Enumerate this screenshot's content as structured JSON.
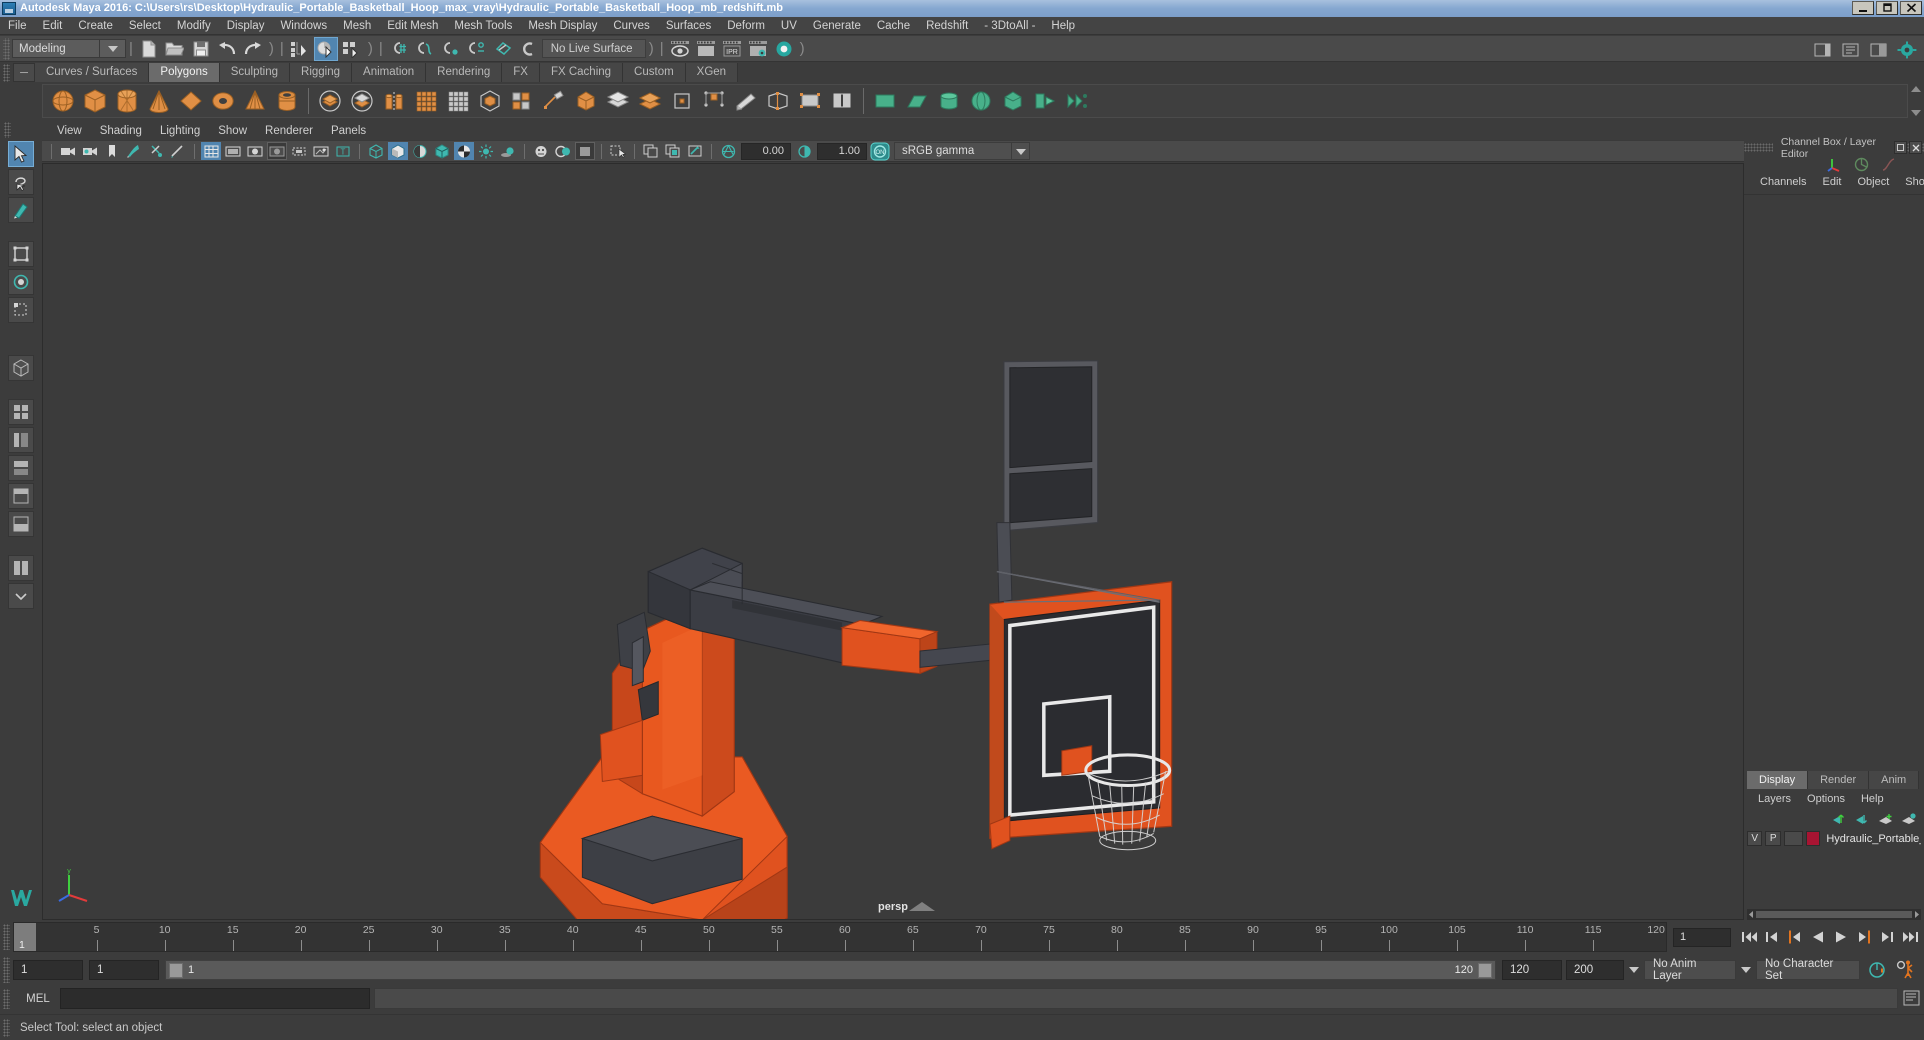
{
  "titlebar": {
    "title": "Autodesk Maya 2016: C:\\Users\\rs\\Desktop\\Hydraulic_Portable_Basketball_Hoop_max_vray\\Hydraulic_Portable_Basketball_Hoop_mb_redshift.mb",
    "minimize": "_",
    "restore": "❐",
    "close": "✕"
  },
  "menubar": {
    "items": [
      "File",
      "Edit",
      "Create",
      "Select",
      "Modify",
      "Display",
      "Windows",
      "Mesh",
      "Edit Mesh",
      "Mesh Tools",
      "Mesh Display",
      "Curves",
      "Surfaces",
      "Deform",
      "UV",
      "Generate",
      "Cache",
      "Redshift",
      "- 3DtoAll -",
      "Help"
    ]
  },
  "statusbar": {
    "menu_set": "Modeling",
    "live_surface": "No Live Surface",
    "icons": [
      "new-scene-icon",
      "open-scene-icon",
      "save-scene-icon",
      "undo-icon",
      "redo-icon",
      "select-by-hierarchy-icon",
      "select-by-object-icon",
      "select-by-component-icon",
      "snap-to-grid-icon",
      "snap-to-curve-icon",
      "snap-to-point-icon",
      "snap-to-projected-center-icon",
      "snap-to-view-plane-icon",
      "magnet-icon",
      "render-current-frame-icon",
      "render-sequence-icon",
      "ipr-render-icon",
      "render-settings-icon",
      "hypershade-icon"
    ],
    "right_icons": [
      "sidebar-toggle-icon",
      "attribute-editor-icon",
      "channel-box-icon",
      "tool-settings-icon"
    ]
  },
  "shelf": {
    "tabs": [
      "Curves / Surfaces",
      "Polygons",
      "Sculpting",
      "Rigging",
      "Animation",
      "Rendering",
      "FX",
      "FX Caching",
      "Custom",
      "XGen"
    ],
    "active_tab": "Polygons",
    "icons": [
      "poly-sphere-icon",
      "poly-cube-icon",
      "poly-cylinder-icon",
      "poly-cone-icon",
      "poly-plane-icon",
      "poly-torus-icon",
      "poly-prism-icon",
      "poly-pipe-icon",
      "poly-helix-icon",
      "poly-soccer-ball-icon",
      "poly-platonic-icon",
      "poly-pyramid-icon",
      "poly-type-icon",
      "poly-svg-icon",
      "combine-icon",
      "separate-icon",
      "booleans-icon",
      "smooth-icon",
      "extrude-icon",
      "bevel-icon",
      "bridge-icon",
      "append-polygon-icon",
      "multi-cut-icon",
      "target-weld-icon",
      "quad-draw-icon",
      "mirror-icon",
      "uv-editor-icon",
      "uv-planar-icon",
      "uv-cylindrical-icon",
      "uv-spherical-icon",
      "uv-automatic-icon",
      "uv-unfold-icon"
    ]
  },
  "toolbox": {
    "tools": [
      {
        "name": "select-tool",
        "selected": true
      },
      {
        "name": "lasso-select-tool",
        "selected": false
      },
      {
        "name": "paint-select-tool",
        "selected": false
      },
      {
        "name": "move-tool",
        "selected": false
      },
      {
        "name": "rotate-tool",
        "selected": false
      },
      {
        "name": "scale-tool",
        "selected": false
      },
      {
        "name": "last-tool-used",
        "selected": false
      },
      {
        "name": "single-perspective-view",
        "selected": false
      },
      {
        "name": "four-view-layout",
        "selected": false
      },
      {
        "name": "persp-outliner-layout",
        "selected": false
      },
      {
        "name": "persp-graph-layout",
        "selected": false
      },
      {
        "name": "hypershade-persp-layout",
        "selected": false
      },
      {
        "name": "persp-hypergraph-layout",
        "selected": false
      },
      {
        "name": "two-pane-layout",
        "selected": false
      },
      {
        "name": "more-layouts",
        "selected": false
      }
    ]
  },
  "viewport": {
    "menus": [
      "View",
      "Shading",
      "Lighting",
      "Show",
      "Renderer",
      "Panels"
    ],
    "toolbar": {
      "exposure": "0.00",
      "gamma": "1.00",
      "color_management": "sRGB gamma",
      "cm_toggle": "ON",
      "icons": [
        "camera-attributes-icon",
        "camera-settings-icon",
        "bookmark-icon",
        "image-plane-icon",
        "two-sided-lighting-icon",
        "wireframe-on-shaded-icon",
        "grid-icon",
        "film-gate-icon",
        "resolution-gate-icon",
        "gate-mask-icon",
        "fields-icon",
        "xray-icon",
        "text-icon",
        "wireframe-shading-icon",
        "smooth-shade-all-icon",
        "shade-hardware-texture-icon",
        "flat-shade-icon",
        "use-default-material-icon",
        "light-icon",
        "shadows-icon",
        "xray-joints-icon",
        "xray-active-components-icon",
        "isolate-select-icon",
        "select-mask-icon",
        "grid-snapping-icon",
        "keep-image-icon",
        "ipr-snapshot-icon"
      ]
    },
    "camera_label": "persp",
    "scene": {
      "object_name": "Hydraulic Portable Basketball Hoop",
      "orange_color": "#e8561f",
      "dark_color": "#3b3c40",
      "backboard_color": "#2b2b2e"
    }
  },
  "right_panel": {
    "title": "Channel Box / Layer Editor",
    "header_menus": [
      "Channels",
      "Edit",
      "Object",
      "Show"
    ],
    "header_icons": [
      "channel-box-icon",
      "attribute-editor-icon",
      "anim-layer-icon"
    ],
    "layer_editor": {
      "tabs": [
        "Display",
        "Render",
        "Anim"
      ],
      "active_tab": "Display",
      "menus": [
        "Layers",
        "Options",
        "Help"
      ],
      "toolbar_icons": [
        "move-layer-up-icon",
        "move-layer-down-icon",
        "new-layer-icon",
        "new-layer-from-selected-icon"
      ],
      "layers": [
        {
          "visibility": "V",
          "playback": "P",
          "type": "",
          "color": "#a81432",
          "name": "Hydraulic_Portable_Ba"
        }
      ]
    }
  },
  "timeline": {
    "ticks": [
      5,
      10,
      15,
      20,
      25,
      30,
      35,
      40,
      45,
      50,
      55,
      60,
      65,
      70,
      75,
      80,
      85,
      90,
      95,
      100,
      105,
      110,
      115,
      120
    ],
    "current_frame": "1",
    "end_label": "120",
    "frame_field": "1",
    "playback_buttons": [
      "go-to-start-icon",
      "step-back-keyframe-icon",
      "step-back-frame-icon",
      "play-backwards-icon",
      "play-forwards-icon",
      "step-forward-frame-icon",
      "step-forward-keyframe-icon",
      "go-to-end-icon"
    ]
  },
  "range": {
    "start_field": "1",
    "playback_start_field": "1",
    "slider_start": "1",
    "slider_end": "120",
    "playback_end_field": "120",
    "end_field": "200",
    "anim_layer": "No Anim Layer",
    "character_set": "No Character Set",
    "right_icons": [
      "auto-keyframe-icon",
      "animation-preferences-icon"
    ]
  },
  "command_line": {
    "label": "MEL",
    "input_value": "",
    "output_value": "",
    "script-editor-icon": "script-editor-icon"
  },
  "status_line": {
    "message": "Select Tool: select an object"
  }
}
